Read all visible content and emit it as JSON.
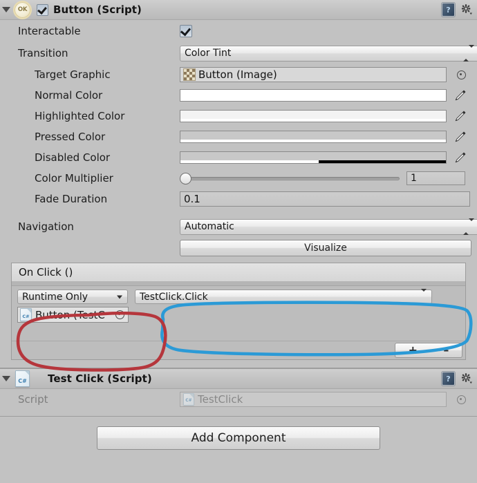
{
  "button_component": {
    "title": "Button (Script)",
    "icon": "ok-badge-icon",
    "enabled_checkbox": true,
    "help_icon": "help-book-icon",
    "settings_icon": "gear-icon",
    "rows": {
      "interactable": {
        "label": "Interactable",
        "value": true
      },
      "transition": {
        "label": "Transition",
        "value": "Color Tint"
      },
      "target_graphic": {
        "label": "Target Graphic",
        "value": "Button (Image)"
      },
      "normal_color": {
        "label": "Normal Color",
        "color": "#ffffff",
        "alpha": 1.0
      },
      "highlighted_color": {
        "label": "Highlighted Color",
        "color": "#f5f5f5",
        "alpha": 1.0
      },
      "pressed_color": {
        "label": "Pressed Color",
        "color": "#c8c8c8",
        "alpha": 1.0
      },
      "disabled_color": {
        "label": "Disabled Color",
        "color": "#c8c8c8",
        "alpha": 0.5
      },
      "color_multiplier": {
        "label": "Color Multiplier",
        "value": "1",
        "slider_pct": 0
      },
      "fade_duration": {
        "label": "Fade Duration",
        "value": "0.1"
      },
      "navigation": {
        "label": "Navigation",
        "value": "Automatic"
      },
      "visualize": {
        "label": "Visualize"
      }
    },
    "on_click": {
      "header": "On Click ()",
      "entry": {
        "runtime_mode": "Runtime Only",
        "object_ref": "Button (TestC",
        "function": "TestClick.Click",
        "object_icon": "cs-script-icon"
      },
      "add_label": "+",
      "remove_label": "–"
    }
  },
  "testclick_component": {
    "title": "Test Click (Script)",
    "icon": "cs-script-icon",
    "help_icon": "help-book-icon",
    "settings_icon": "gear-icon",
    "script_row": {
      "label": "Script",
      "value": "TestClick"
    }
  },
  "add_component_button": {
    "label": "Add Component"
  },
  "annotations": {
    "red_ellipse": {
      "color": "#b5363c",
      "target": "runtime-only-and-object-field"
    },
    "blue_ellipse": {
      "color": "#2b9ad6",
      "target": "function-dropdown"
    }
  }
}
